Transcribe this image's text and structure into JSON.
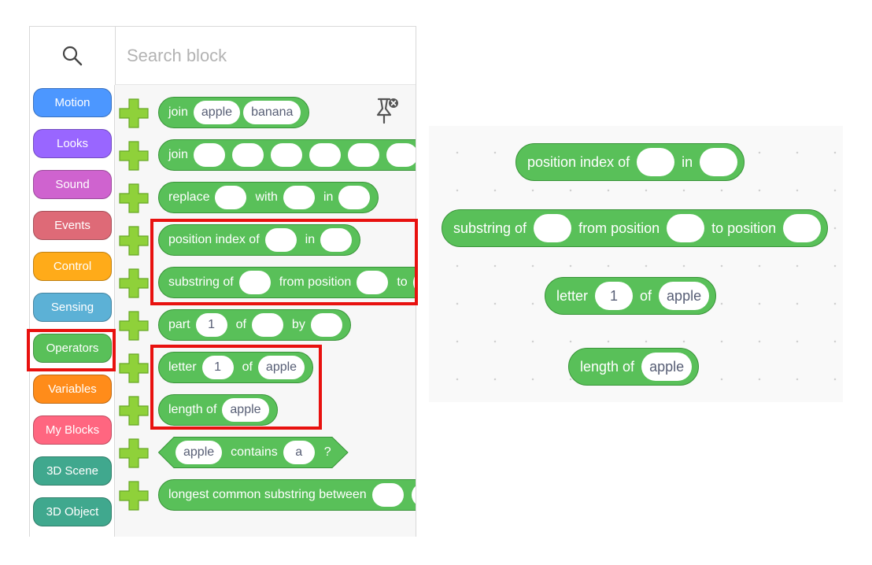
{
  "search": {
    "placeholder": "Search block"
  },
  "categories": [
    {
      "label": "Motion",
      "color": "#4c97ff"
    },
    {
      "label": "Looks",
      "color": "#9966ff"
    },
    {
      "label": "Sound",
      "color": "#cf63cf"
    },
    {
      "label": "Events",
      "color": "#de6a77"
    },
    {
      "label": "Control",
      "color": "#ffab19"
    },
    {
      "label": "Sensing",
      "color": "#5cb1d6"
    },
    {
      "label": "Operators",
      "color": "#59c059"
    },
    {
      "label": "Variables",
      "color": "#ff8c1a"
    },
    {
      "label": "My Blocks",
      "color": "#ff6680"
    },
    {
      "label": "3D Scene",
      "color": "#40a88e"
    },
    {
      "label": "3D Object",
      "color": "#40a88e"
    }
  ],
  "selected_category": "Operators",
  "blocks": {
    "join1": {
      "join": "join",
      "a": "apple",
      "b": "banana"
    },
    "join2": {
      "join": "join"
    },
    "replace": {
      "replace": "replace",
      "with": "with",
      "in": "in"
    },
    "position_index": {
      "text": "position index of",
      "in": "in"
    },
    "substring": {
      "text": "substring of",
      "from": "from position",
      "to": "to"
    },
    "part": {
      "part": "part",
      "one": "1",
      "of": "of",
      "by": "by"
    },
    "letter": {
      "letter": "letter",
      "one": "1",
      "of": "of",
      "apple": "apple"
    },
    "length": {
      "text": "length of",
      "apple": "apple"
    },
    "contains": {
      "apple": "apple",
      "contains": "contains",
      "a": "a",
      "q": "?"
    },
    "longest": {
      "text": "longest common substring between"
    }
  },
  "workspace": {
    "position_index": {
      "text": "position index of",
      "in": "in"
    },
    "substring": {
      "text": "substring of",
      "from": "from position",
      "to": "to position"
    },
    "letter": {
      "letter": "letter",
      "one": "1",
      "of": "of",
      "apple": "apple"
    },
    "length": {
      "text": "length of",
      "apple": "apple"
    }
  },
  "colors": {
    "operator_green": "#59c059",
    "operator_border": "#389438",
    "highlight": "#e8110f",
    "plus_green": "#8fd13a"
  }
}
